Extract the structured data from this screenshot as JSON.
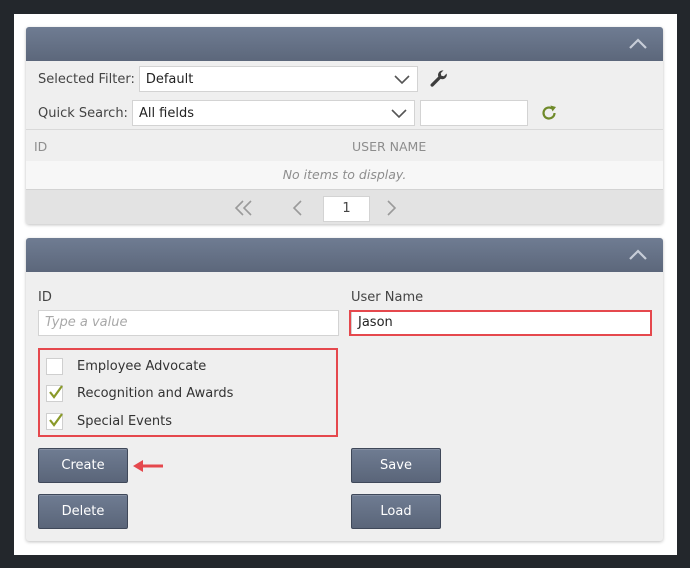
{
  "filter_panel": {
    "selected_filter_label": "Selected Filter:",
    "selected_filter_value": "Default",
    "quick_search_label": "Quick Search:",
    "quick_search_scope": "All fields",
    "quick_search_value": "",
    "columns": [
      "ID",
      "USER NAME"
    ],
    "empty_message": "No items to display.",
    "current_page": "1",
    "icons": {
      "collapse": "chevron-up-icon",
      "filter_settings": "wrench-icon",
      "refresh": "refresh-icon",
      "first_page": "double-chevron-left-icon",
      "prev_page": "chevron-left-icon",
      "next_page": "chevron-right-icon"
    }
  },
  "form_panel": {
    "id_label": "ID",
    "id_placeholder": "Type a value",
    "username_label": "User Name",
    "username_value": "Jason",
    "checkboxes": [
      {
        "label": "Employee Advocate",
        "checked": false
      },
      {
        "label": "Recognition and Awards",
        "checked": true
      },
      {
        "label": "Special Events",
        "checked": true
      }
    ],
    "buttons": {
      "create": "Create",
      "save": "Save",
      "delete": "Delete",
      "load": "Load"
    }
  },
  "colors": {
    "header": "#657086",
    "button": "#65708a",
    "highlight": "#e5484d",
    "check": "#8a9a2a",
    "refresh": "#6f8a2a"
  }
}
